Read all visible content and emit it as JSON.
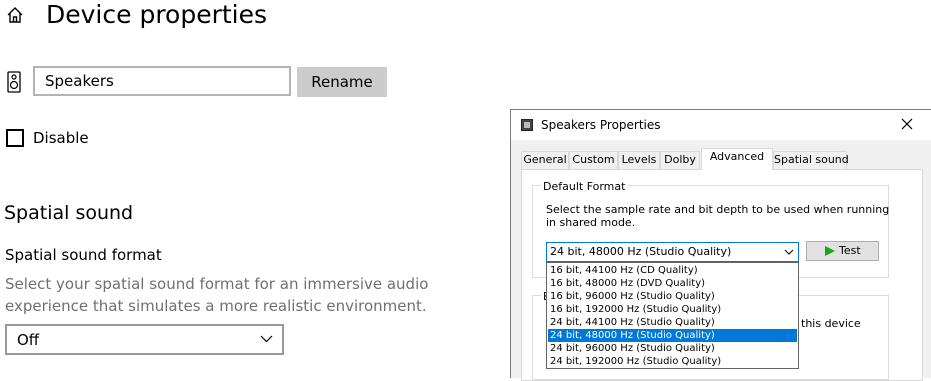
{
  "settings": {
    "page_title": "Device properties",
    "device_name": "Speakers",
    "rename_label": "Rename",
    "disable_label": "Disable",
    "spatial_title": "Spatial sound",
    "spatial_format_label": "Spatial sound format",
    "spatial_format_desc": "Select your spatial sound format for an immersive audio experience that simulates a more realistic environment.",
    "spatial_format_value": "Off"
  },
  "dialog": {
    "title": "Speakers Properties",
    "tabs": [
      "General",
      "Custom",
      "Levels",
      "Dolby",
      "Advanced",
      "Spatial sound"
    ],
    "active_tab": "Advanced",
    "default_format_legend": "Default Format",
    "default_format_desc": "Select the sample rate and bit depth to be used when running in shared mode.",
    "selected_format": "24 bit, 48000 Hz (Studio Quality)",
    "test_label": "Test",
    "second_group_legend_fragment": "E",
    "second_group_text_fragment": "this device",
    "format_options": [
      "16 bit, 44100 Hz (CD Quality)",
      "16 bit, 48000 Hz (DVD Quality)",
      "16 bit, 96000 Hz (Studio Quality)",
      "16 bit, 192000 Hz (Studio Quality)",
      "24 bit, 44100 Hz (Studio Quality)",
      "24 bit, 48000 Hz (Studio Quality)",
      "24 bit, 96000 Hz (Studio Quality)",
      "24 bit, 192000 Hz (Studio Quality)"
    ],
    "selected_option_index": 5
  },
  "icons": {
    "home": "home-icon",
    "speaker": "speaker-icon",
    "dialog": "speaker-dialog-icon",
    "close": "close-icon",
    "chevron": "chevron-down-icon",
    "test": "play-icon"
  },
  "colors": {
    "accent": "#0078d7",
    "button_gray": "#cccccc",
    "secondary_text": "#707070",
    "test_play": "#17a81a"
  }
}
